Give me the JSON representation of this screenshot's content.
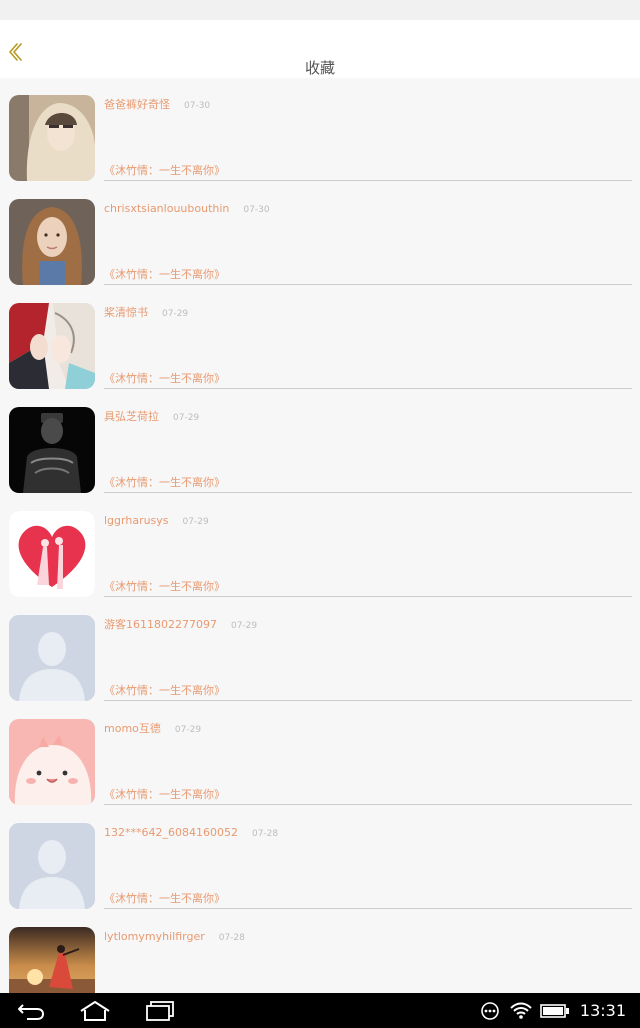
{
  "header": {
    "title": "收藏",
    "back_icon": "chevron-left-icon",
    "accent_color": "#b59a22"
  },
  "colors": {
    "name_color": "#e89a70",
    "date_color": "#bdbdbd",
    "background": "#f7f7f7",
    "divider": "#cccccc"
  },
  "items": [
    {
      "name": "爸爸裤好奇怪",
      "date": "07-30",
      "book": "《沐竹情：一生不离你》",
      "avatar": "hooded-person-avatar"
    },
    {
      "name": "chrisxtsianlouubouthin",
      "date": "07-30",
      "book": "《沐竹情：一生不离你》",
      "avatar": "girl-photo-avatar"
    },
    {
      "name": "桨清惊书",
      "date": "07-29",
      "book": "《沐竹情：一生不离你》",
      "avatar": "anime-couple-avatar"
    },
    {
      "name": "具弘芝荷拉",
      "date": "07-29",
      "book": "《沐竹情：一生不离你》",
      "avatar": "dark-figure-avatar"
    },
    {
      "name": "lggrharusys",
      "date": "07-29",
      "book": "《沐竹情：一生不离你》",
      "avatar": "heart-couple-avatar"
    },
    {
      "name": "游客1611802277097",
      "date": "07-29",
      "book": "《沐竹情：一生不离你》",
      "avatar": "default-user-avatar"
    },
    {
      "name": "momo互德",
      "date": "07-29",
      "book": "《沐竹情：一生不离你》",
      "avatar": "pink-cartoon-avatar"
    },
    {
      "name": "132***642_6084160052",
      "date": "07-28",
      "book": "《沐竹情：一生不离你》",
      "avatar": "default-user-avatar"
    },
    {
      "name": "lytlomymyhilfirger",
      "date": "07-28",
      "book": "",
      "avatar": "sunset-woman-avatar"
    }
  ],
  "navbar": {
    "back_icon": "nav-back-icon",
    "home_icon": "nav-home-icon",
    "recents_icon": "nav-recents-icon",
    "more_icon": "more-dots-icon",
    "wifi_icon": "wifi-icon",
    "battery_icon": "battery-icon",
    "time": "13:31"
  }
}
